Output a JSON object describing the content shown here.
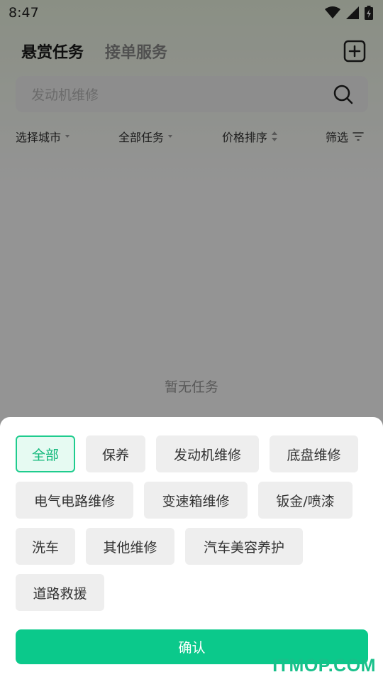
{
  "status": {
    "time": "8:47"
  },
  "header": {
    "tab_active": "悬赏任务",
    "tab_inactive": "接单服务"
  },
  "search": {
    "placeholder": "发动机维修"
  },
  "filters": [
    {
      "label": "选择城市"
    },
    {
      "label": "全部任务"
    },
    {
      "label": "价格排序"
    },
    {
      "label": "筛选"
    }
  ],
  "empty": {
    "text": "暂无任务"
  },
  "sheet": {
    "chips": [
      {
        "label": "全部",
        "selected": true
      },
      {
        "label": "保养"
      },
      {
        "label": "发动机维修"
      },
      {
        "label": "底盘维修"
      },
      {
        "label": "电气电路维修"
      },
      {
        "label": "变速箱维修"
      },
      {
        "label": "钣金/喷漆"
      },
      {
        "label": "洗车"
      },
      {
        "label": "其他维修"
      },
      {
        "label": "汽车美容养护"
      },
      {
        "label": "道路救援"
      }
    ],
    "confirm_label": "确认"
  },
  "watermark": "ITMOP.COM",
  "colors": {
    "accent": "#0bc98b",
    "accent_text": "#12b87b"
  }
}
